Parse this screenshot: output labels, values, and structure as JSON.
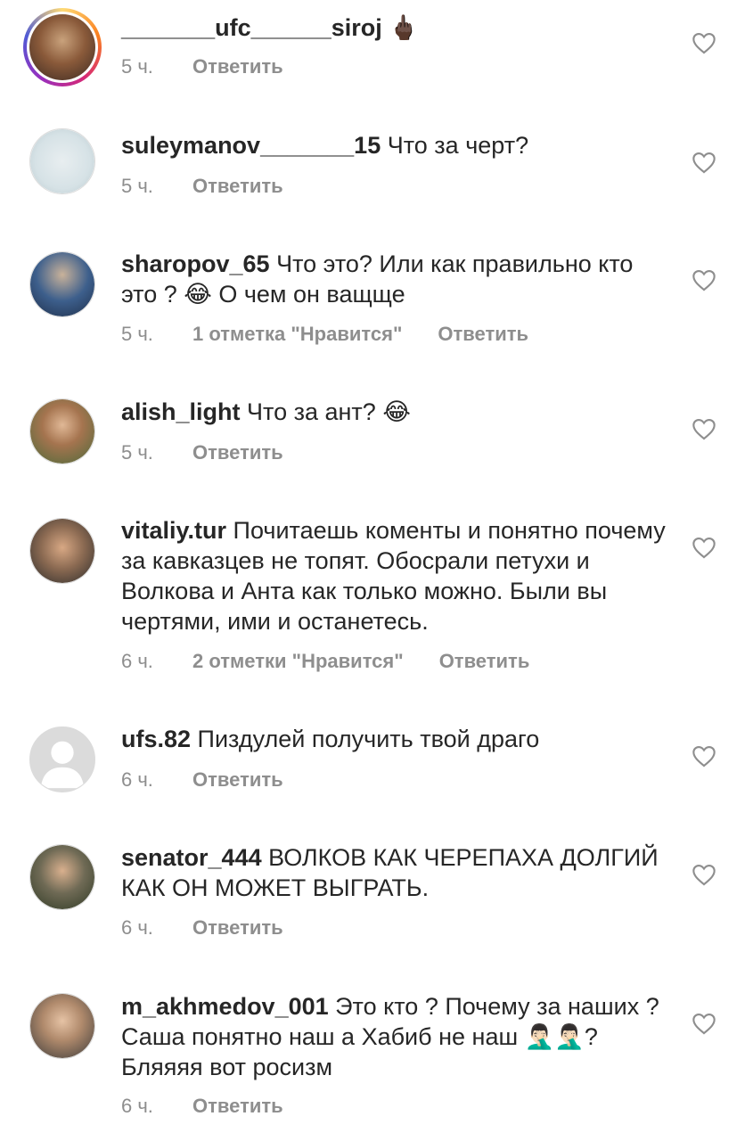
{
  "comments": [
    {
      "username": "_______ufc______siroj",
      "text": "",
      "emoji": "🖕🏿",
      "time": "5 ч.",
      "likes": "",
      "reply": "Ответить"
    },
    {
      "username": "suleymanov_______15",
      "text": " Что за черт?",
      "time": "5 ч.",
      "likes": "",
      "reply": "Ответить"
    },
    {
      "username": "sharopov_65",
      "text": " Что это? Или как правильно кто это ? 😂 О чем он ващще",
      "time": "5 ч.",
      "likes": "1 отметка \"Нравится\"",
      "reply": "Ответить"
    },
    {
      "username": "alish_light",
      "text": " Что за ант? 😂",
      "time": "5 ч.",
      "likes": "",
      "reply": "Ответить"
    },
    {
      "username": "vitaliy.tur",
      "text": " Почитаешь коменты и понятно почему за кавказцев не топят. Обосрали петухи и Волкова и Анта как только можно. Были вы чертями, ими и останетесь.",
      "time": "6 ч.",
      "likes": "2 отметки \"Нравится\"",
      "reply": "Ответить"
    },
    {
      "username": "ufs.82",
      "text": " Пиздулей получить твой драго",
      "time": "6 ч.",
      "likes": "",
      "reply": "Ответить"
    },
    {
      "username": "senator_444",
      "text": " ВОЛКОВ КАК ЧЕРЕПАХА ДОЛГИЙ КАК ОН МОЖЕТ ВЫГРАТЬ.",
      "time": "6 ч.",
      "likes": "",
      "reply": "Ответить"
    },
    {
      "username": "m_akhmedov_001",
      "text": " Это кто ? Почему за наших ? Саша понятно наш а Хабиб не наш 🤦🏻‍♂️🤦🏻‍♂️? Бляяяя вот росизм",
      "time": "6 ч.",
      "likes": "",
      "reply": "Ответить"
    }
  ]
}
